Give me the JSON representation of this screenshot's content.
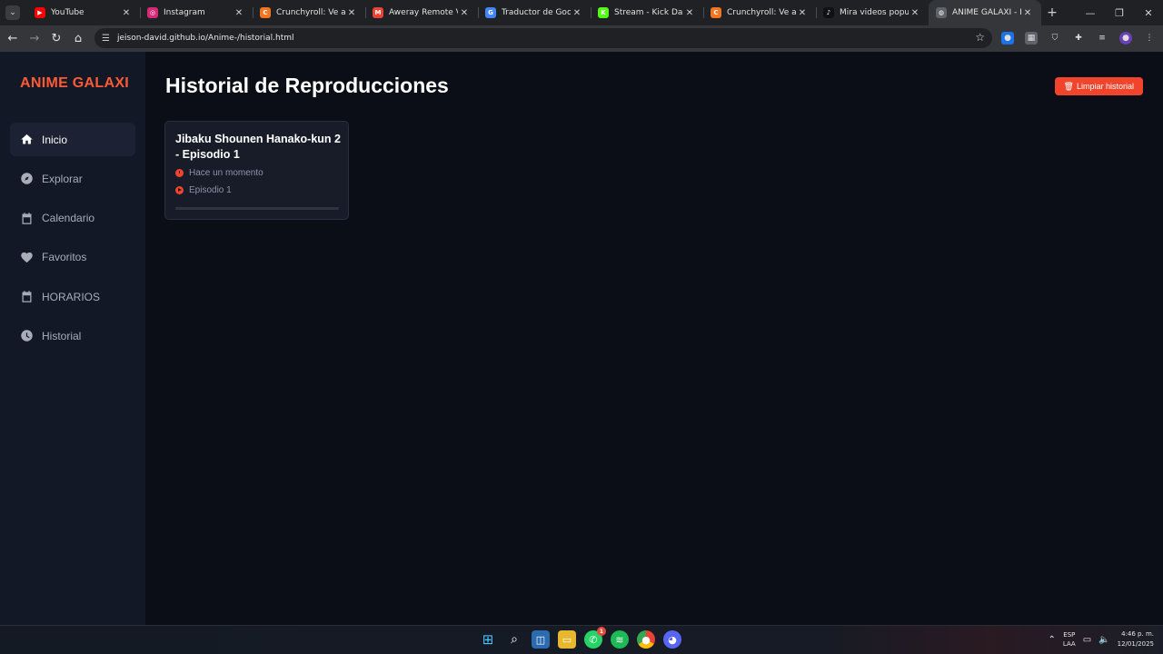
{
  "browser": {
    "tabs": [
      {
        "title": "YouTube",
        "icon": "youtube-icon",
        "color": "#ff0000",
        "glyph": "▶"
      },
      {
        "title": "Instagram",
        "icon": "instagram-icon",
        "color": "#d62976",
        "glyph": "◎"
      },
      {
        "title": "Crunchyroll: Ve anime",
        "icon": "crunchyroll-icon",
        "color": "#f47521",
        "glyph": "C"
      },
      {
        "title": "Aweray Remote Verific",
        "icon": "gmail-icon",
        "color": "#ea4335",
        "glyph": "M"
      },
      {
        "title": "Traductor de Google",
        "icon": "google-translate-icon",
        "color": "#4285f4",
        "glyph": "G"
      },
      {
        "title": "Stream - Kick Dashbo",
        "icon": "kick-icon",
        "color": "#53fc18",
        "glyph": "K"
      },
      {
        "title": "Crunchyroll: Ve anime",
        "icon": "crunchyroll-icon",
        "color": "#f47521",
        "glyph": "C"
      },
      {
        "title": "Mira videos populares",
        "icon": "tiktok-icon",
        "color": "#111111",
        "glyph": "♪"
      },
      {
        "title": "ANIME GALAXI - Histo",
        "icon": "globe-icon",
        "color": "#5f6368",
        "glyph": "◍"
      }
    ],
    "url": "jeison-david.github.io/Anime-/historial.html"
  },
  "sidebar": {
    "brand": "ANIME GALAXI",
    "brand_color": "#ff5a36",
    "items": [
      {
        "label": "Inicio",
        "icon": "home-icon"
      },
      {
        "label": "Explorar",
        "icon": "compass-icon"
      },
      {
        "label": "Calendario",
        "icon": "calendar-icon"
      },
      {
        "label": "Favoritos",
        "icon": "heart-icon"
      },
      {
        "label": "HORARIOS",
        "icon": "calendar-icon"
      },
      {
        "label": "Historial",
        "icon": "clock-icon"
      }
    ]
  },
  "main": {
    "title": "Historial de Reproducciones",
    "clear_button": "Limpiar historial",
    "accent_color": "#f0452c",
    "history": [
      {
        "title": "Jibaku Shounen Hanako-kun 2 - Episodio 1",
        "time": "Hace un momento",
        "episode": "Episodio 1",
        "progress": 0
      }
    ]
  },
  "taskbar": {
    "apps": [
      "windows-start-icon",
      "search-icon",
      "store-icon",
      "file-explorer-icon",
      "whatsapp-icon",
      "spotify-icon",
      "chrome-icon",
      "discord-icon"
    ],
    "whatsapp_badge": "1",
    "lang_top": "ESP",
    "lang_bottom": "LAA",
    "time": "4:46 p. m.",
    "date": "12/01/2025"
  }
}
